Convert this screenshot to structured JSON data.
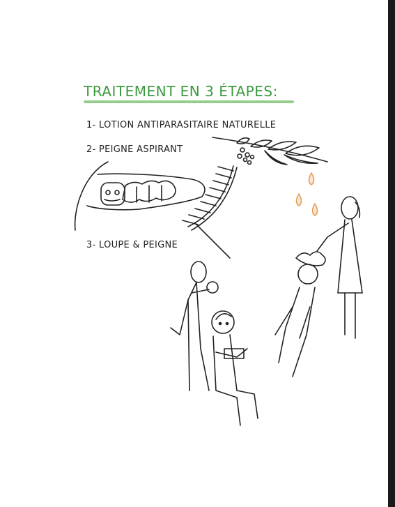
{
  "title": "TRAITEMENT EN 3 ÉTAPES:",
  "steps": [
    {
      "label": "1- LOTION ANTIPARASITAIRE NATURELLE"
    },
    {
      "label": "2- PEIGNE ASPIRANT"
    },
    {
      "label": "3- LOUPE & PEIGNE"
    }
  ],
  "colors": {
    "title": "#3a9a3e",
    "underline": "#7cc06d",
    "drops": "#e0a060",
    "ink": "#222222"
  },
  "icons": [
    "lavender-sprig-icon",
    "oil-drops-icon",
    "louse-icon",
    "comb-icon",
    "stick-figures-icon"
  ]
}
